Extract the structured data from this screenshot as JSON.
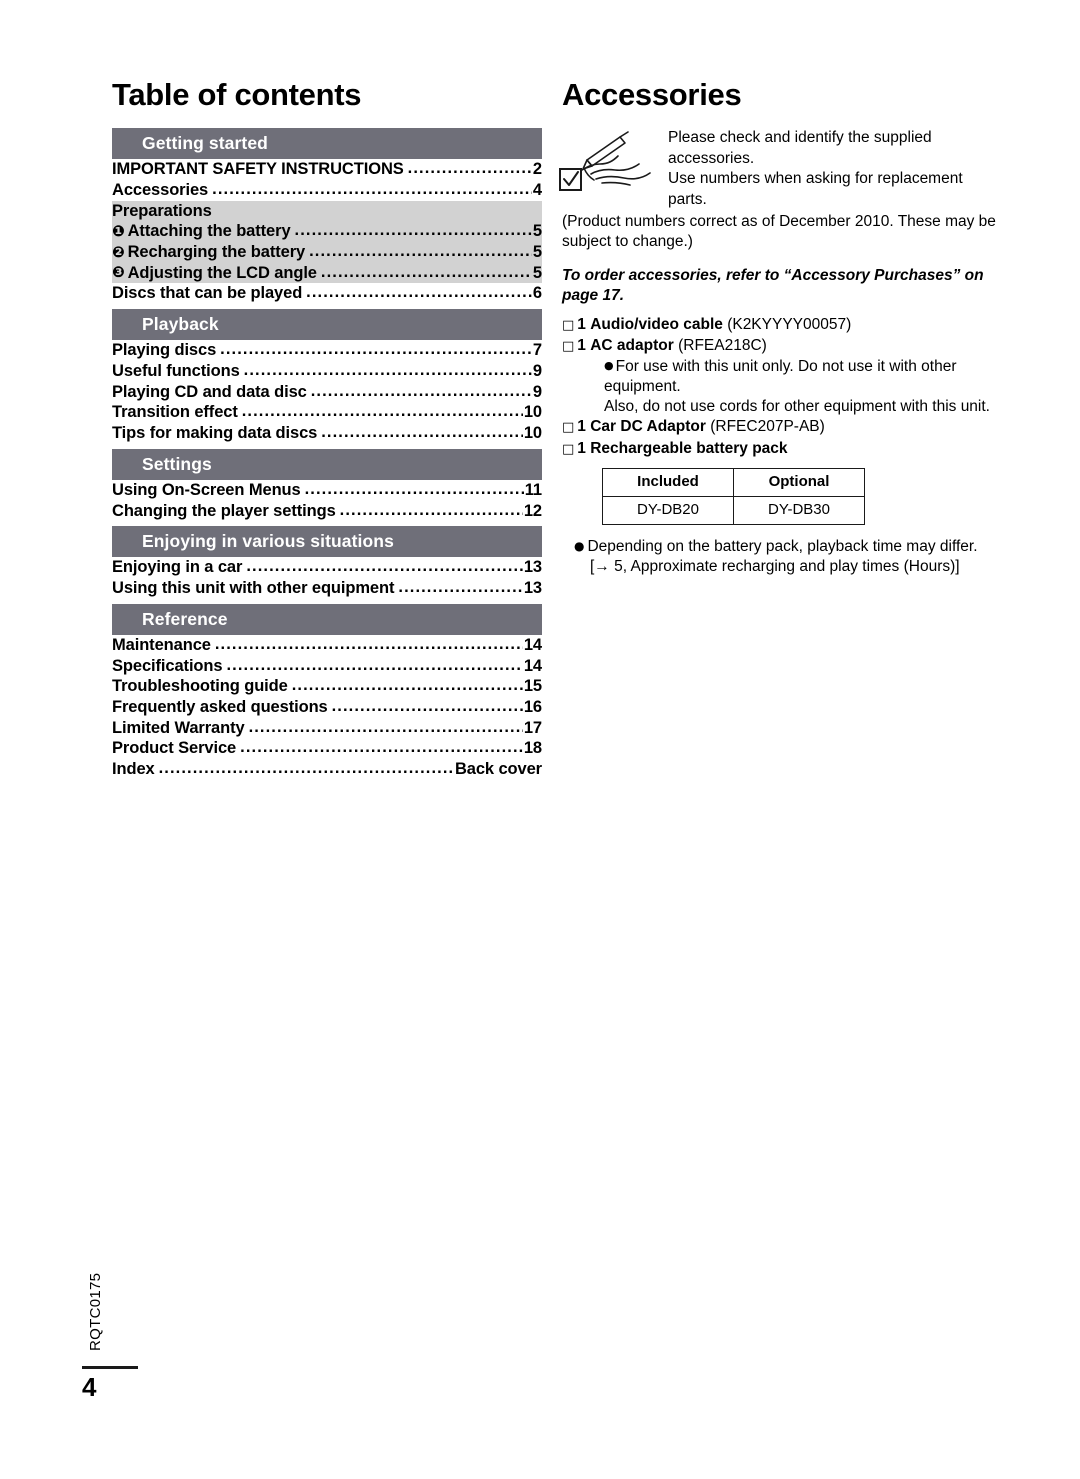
{
  "footer": {
    "code": "RQTC0175",
    "page_number": "4"
  },
  "toc": {
    "title": "Table of contents",
    "sections": [
      {
        "band": "Getting started",
        "rows": [
          {
            "label": "IMPORTANT SAFETY INSTRUCTIONS",
            "page": "2",
            "leader": true,
            "shaded": false
          },
          {
            "label": "Accessories",
            "page": "4",
            "leader": true,
            "shaded": false
          },
          {
            "label": "Preparations",
            "page": "",
            "leader": false,
            "shaded": true
          },
          {
            "glyph": "❶",
            "label": "Attaching the battery",
            "page": "5",
            "leader": true,
            "shaded": true
          },
          {
            "glyph": "❷",
            "label": "Recharging the battery",
            "page": "5",
            "leader": true,
            "shaded": true
          },
          {
            "glyph": "❸",
            "label": "Adjusting the LCD angle",
            "page": "5",
            "leader": true,
            "shaded": true
          },
          {
            "label": "Discs that can be played",
            "page": "6",
            "leader": true,
            "shaded": false
          }
        ]
      },
      {
        "band": "Playback",
        "rows": [
          {
            "label": "Playing discs",
            "page": "7",
            "leader": true,
            "shaded": false
          },
          {
            "label": "Useful functions",
            "page": "9",
            "leader": true,
            "shaded": false
          },
          {
            "label": "Playing CD and data disc",
            "page": "9",
            "leader": true,
            "shaded": false
          },
          {
            "label": "Transition effect",
            "page": "10",
            "leader": true,
            "shaded": false
          },
          {
            "label": "Tips for making data discs",
            "page": "10",
            "leader": true,
            "shaded": false
          }
        ]
      },
      {
        "band": "Settings",
        "rows": [
          {
            "label": "Using On-Screen Menus",
            "page": "11",
            "leader": true,
            "shaded": false
          },
          {
            "label": "Changing the player settings",
            "page": "12",
            "leader": true,
            "shaded": false
          }
        ]
      },
      {
        "band": "Enjoying in various situations",
        "rows": [
          {
            "label": "Enjoying in a car",
            "page": "13",
            "leader": true,
            "shaded": false
          },
          {
            "label": "Using this unit with other equipment",
            "page": "13",
            "leader": true,
            "shaded": false
          }
        ]
      },
      {
        "band": "Reference",
        "rows": [
          {
            "label": "Maintenance",
            "page": "14",
            "leader": true,
            "shaded": false
          },
          {
            "label": "Specifications",
            "page": "14",
            "leader": true,
            "shaded": false
          },
          {
            "label": "Troubleshooting guide",
            "page": "15",
            "leader": true,
            "shaded": false
          },
          {
            "label": "Frequently asked questions",
            "page": "16",
            "leader": true,
            "shaded": false
          },
          {
            "label": "Limited Warranty",
            "page": "17",
            "leader": true,
            "shaded": false
          },
          {
            "label": "Product Service",
            "page": "18",
            "leader": true,
            "shaded": false
          },
          {
            "label": "Index",
            "page": "Back cover",
            "leader": true,
            "shaded": false
          }
        ]
      }
    ]
  },
  "accessories": {
    "title": "Accessories",
    "intro_line1": "Please check and identify the supplied",
    "intro_line2": "accessories.",
    "intro_line3": "Use numbers when asking for replacement parts.",
    "intro_paragraph": "(Product numbers correct as of December 2010. These may be subject to change.)",
    "order_note": "To order accessories, refer to “Accessory Purchases” on page 17.",
    "checkbox_glyph": "□",
    "bullet_glyph": "●",
    "items": [
      {
        "qty": "1",
        "name": "Audio/video cable",
        "code": "(K2KYYYY00057)"
      },
      {
        "qty": "1",
        "name": "AC adaptor",
        "code": "(RFEA218C)"
      },
      {
        "qty": "1",
        "name": "Car DC Adaptor",
        "code": "(RFEC207P-AB)"
      },
      {
        "qty": "1",
        "name": "Rechargeable battery pack",
        "code": ""
      }
    ],
    "ac_note_line1": "For use with this unit only. Do not use it with other",
    "ac_note_line2": "equipment.",
    "ac_note_line3": "Also, do not use cords for other equipment with this unit.",
    "battery_table": {
      "headers": [
        "Included",
        "Optional"
      ],
      "rows": [
        [
          "DY-DB20",
          "DY-DB30"
        ]
      ]
    },
    "battery_note_line1": "Depending on the battery pack, playback time may differ.",
    "battery_note_line2": "[→ 5, Approximate recharging and play times (Hours)]"
  },
  "colors": {
    "band_gray": "#6f6f79",
    "shade_gray": "#d2d2d2",
    "text": "#000000"
  }
}
